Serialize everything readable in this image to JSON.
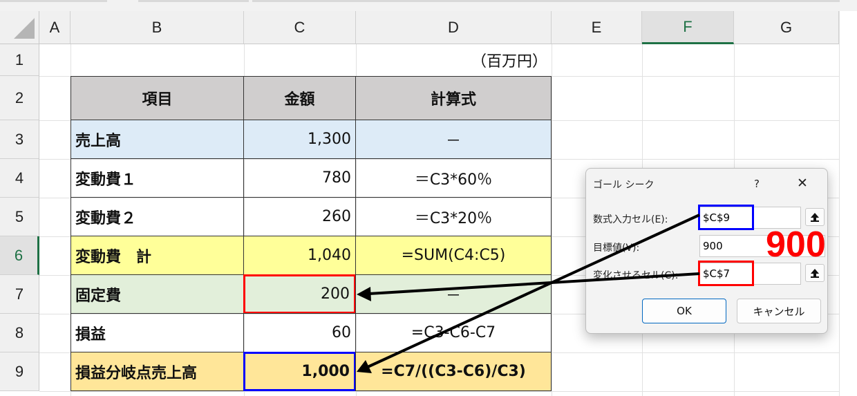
{
  "columns": [
    "A",
    "B",
    "C",
    "D",
    "E",
    "F",
    "G"
  ],
  "rows": [
    "1",
    "2",
    "3",
    "4",
    "5",
    "6",
    "7",
    "8",
    "9"
  ],
  "unit_label": "（百万円）",
  "table": {
    "headers": [
      "項目",
      "金額",
      "計算式"
    ],
    "rows": [
      {
        "item": "売上高",
        "amount": "1,300",
        "formula": "－"
      },
      {
        "item": "変動費１",
        "amount": "780",
        "formula": "＝C3*60％"
      },
      {
        "item": "変動費２",
        "amount": "260",
        "formula": "＝C3*20％"
      },
      {
        "item": "変動費　計",
        "amount": "1,040",
        "formula": "=SUM(C4:C5)"
      },
      {
        "item": "固定費",
        "amount": "200",
        "formula": "－"
      },
      {
        "item": "損益",
        "amount": "60",
        "formula": "=C3-C6-C7"
      },
      {
        "item": "損益分岐点売上高",
        "amount": "1,000",
        "formula": "=C7/((C3-C6)/C3)"
      }
    ]
  },
  "colors": {
    "header_gray": "#d0cece",
    "sales_blue": "#ddebf7",
    "subtotal_yellow": "#ffff99",
    "fixed_green": "#e2efda",
    "breakeven_orange": "#ffe699",
    "highlight_red": "#ff0000",
    "highlight_blue": "#0000ff",
    "accent_green": "#1e7145"
  },
  "dialog": {
    "title": "ゴール シーク",
    "help": "?",
    "close": "✕",
    "set_cell_label": "数式入力セル(E):",
    "set_cell_value": "$C$9",
    "to_value_label": "目標値(V):",
    "to_value_value": "900",
    "by_changing_label": "変化させるセル(C):",
    "by_changing_value": "$C$7",
    "ok": "OK",
    "cancel": "キャンセル",
    "ref_icon": "collapse-arrow-icon"
  },
  "annotation": {
    "big_number": "900"
  }
}
